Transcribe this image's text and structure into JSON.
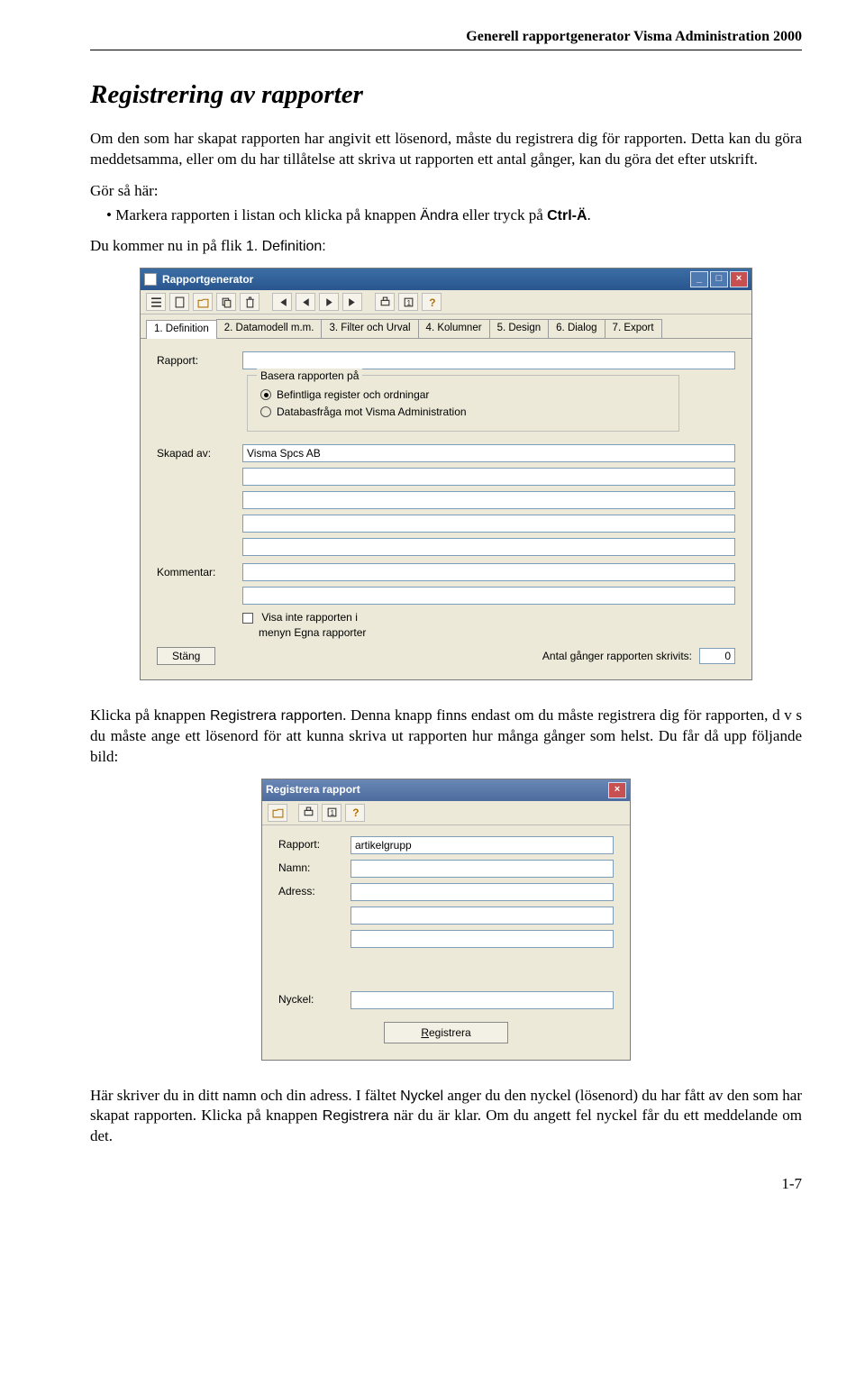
{
  "header": "Generell rapportgenerator Visma Administration 2000",
  "title": "Registrering av rapporter",
  "intro1": "Om den som har skapat rapporten har angivit ett lösenord, måste du registrera dig för rapporten. Detta kan du göra meddetsamma, eller om du har tillåtelse att skriva ut rapporten ett antal gånger,  kan du göra det efter utskrift.",
  "gor": "Gör  så  här:",
  "bullet_pre": "Markera rapporten i listan och klicka på knappen ",
  "bullet_andra": "Ändra",
  "bullet_mid": " eller tryck på ",
  "bullet_ctrl": "Ctrl-Ä",
  "bullet_post": ".",
  "line_dukommer_pre": "Du kommer nu in på flik ",
  "line_dukommer_tab": "1. Definition:",
  "win1": {
    "title": "Rapportgenerator",
    "tabs": [
      "1. Definition",
      "2. Datamodell m.m.",
      "3. Filter och Urval",
      "4. Kolumner",
      "5. Design",
      "6. Dialog",
      "7. Export"
    ],
    "lbl_rapport": "Rapport:",
    "group_legend": "Basera rapporten på",
    "radio1": "Befintliga register och ordningar",
    "radio2": "Databasfråga mot Visma Administration",
    "lbl_skapad": "Skapad av:",
    "skapad_val": "Visma Spcs AB",
    "lbl_kommentar": "Kommentar:",
    "check_label1": "Visa inte rapporten i",
    "check_label2": "menyn Egna rapporter",
    "antal_label": "Antal gånger rapporten skrivits:",
    "antal_val": "0",
    "btn_stang": "Stäng"
  },
  "mid1_pre": "Klicka på knappen ",
  "mid1_reg": "Registrera rapporten",
  "mid1_post": ". Denna knapp finns endast om du måste registrera dig för rapporten, d v s du måste ange ett lösenord för att kunna skriva ut rapporten hur många gånger som helst. Du får då upp följande bild:",
  "win2": {
    "title": "Registrera rapport",
    "lbl_rapport": "Rapport:",
    "rapport_val": "artikelgrupp",
    "lbl_namn": "Namn:",
    "lbl_adress": "Adress:",
    "lbl_nyckel": "Nyckel:",
    "btn_reg": "Registrera"
  },
  "tail_a": "Här skriver du in ditt namn och din adress. I fältet ",
  "tail_nyckel": "Nyckel",
  "tail_b": " anger du den nyckel (lösenord) du har fått av den som har skapat rapporten. Klicka på knappen ",
  "tail_reg": "Registrera",
  "tail_c": " när du är klar. Om du angett fel nyckel får du ett meddelande om det.",
  "page": "1-7"
}
